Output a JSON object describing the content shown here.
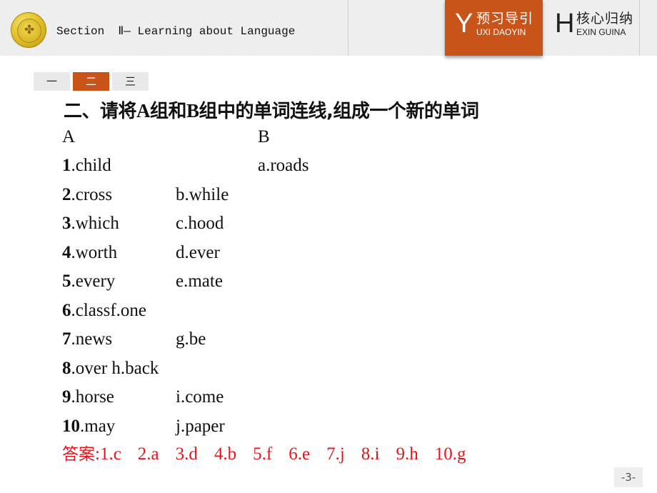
{
  "header": {
    "logo_icon": "school-emblem-coin",
    "section_title": "Section  Ⅱ— Learning about Language",
    "nav_tabs": [
      {
        "letter": "Y",
        "label_cn": "预习导引",
        "label_en": "UXI DAOYIN",
        "active": true
      },
      {
        "letter": "H",
        "label_cn": "核心归纳",
        "label_en": "EXIN GUINA",
        "active": false
      }
    ]
  },
  "sub_tabs": [
    {
      "label": "一",
      "active": false
    },
    {
      "label": "二",
      "active": true
    },
    {
      "label": "三",
      "active": false
    }
  ],
  "exercise": {
    "heading_pre": "二、请将",
    "heading_a": "A",
    "heading_mid": "组和",
    "heading_b": "B",
    "heading_post": "组中的单词连线,组成一个新的单词",
    "col_a_header": "A",
    "col_b_header": "B",
    "rows": [
      {
        "num": "1",
        "a": ".child",
        "b": "a.roads"
      },
      {
        "num": "2",
        "a": ".cross",
        "b": "b.while"
      },
      {
        "num": "3",
        "a": ".which",
        "b": "c.hood"
      },
      {
        "num": "4",
        "a": ".worth",
        "b": "d.ever"
      },
      {
        "num": "5",
        "a": ".every",
        "b": "e.mate"
      },
      {
        "num": "6",
        "a": ".classf.one",
        "b": ""
      },
      {
        "num": "7",
        "a": ".news",
        "b": "g.be"
      },
      {
        "num": "8",
        "a": ".over h.back",
        "b": ""
      },
      {
        "num": "9",
        "a": ".horse",
        "b": "i.come"
      },
      {
        "num": "10",
        "a": ".may",
        "b": "j.paper"
      }
    ],
    "answer_label": "答案",
    "answers": [
      ":1.c",
      "2.a",
      "3.d",
      "4.b",
      "5.f",
      "6.e",
      "7.j",
      "8.i",
      "9.h",
      "10.g"
    ]
  },
  "colors": {
    "accent": "#c9541a",
    "answer": "#e8141b"
  },
  "page_number": "-3-"
}
